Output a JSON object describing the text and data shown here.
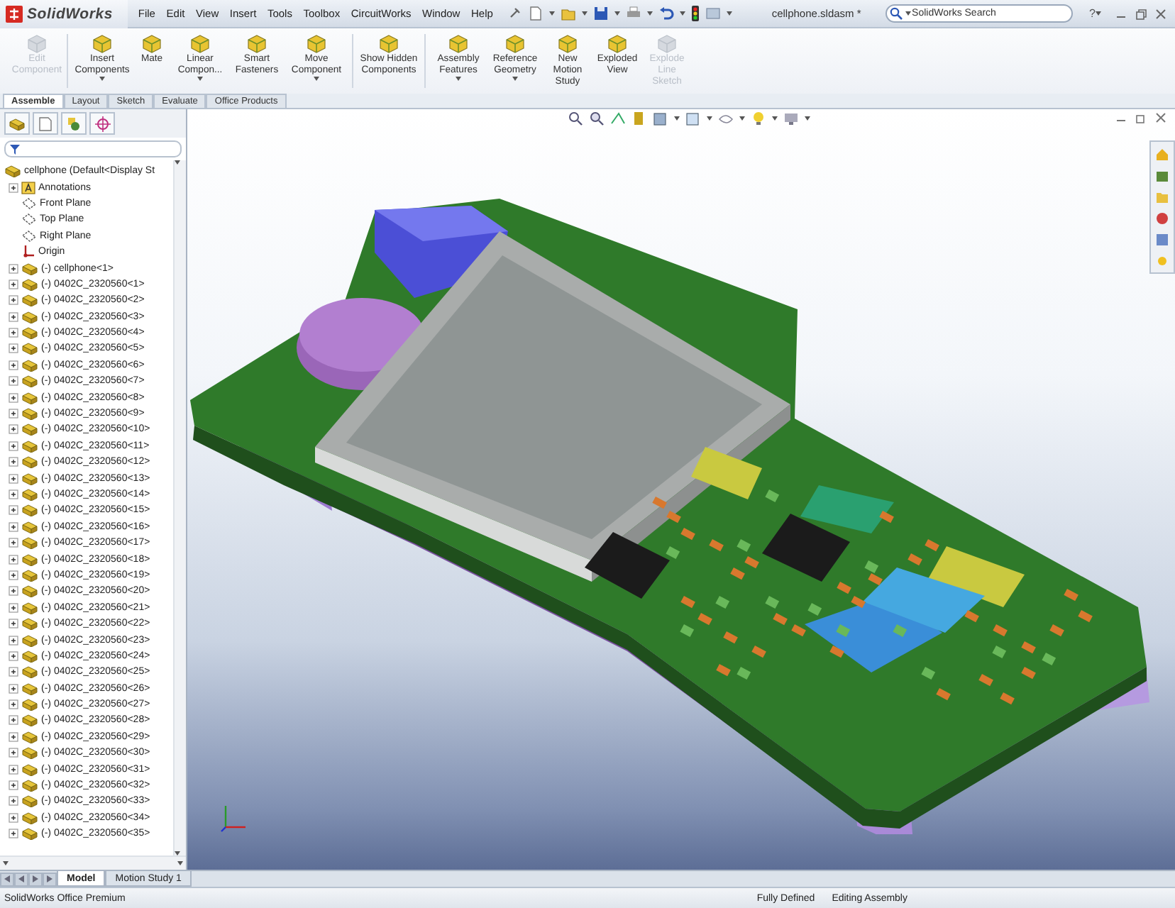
{
  "title_bar": {
    "app_name": "SolidWorks",
    "menu": [
      "File",
      "Edit",
      "View",
      "Insert",
      "Tools",
      "Toolbox",
      "CircuitWorks",
      "Window",
      "Help"
    ],
    "document_title": "cellphone.sldasm *",
    "search": {
      "placeholder": "SolidWorks Search"
    },
    "help_label": "?"
  },
  "ribbon": {
    "commands": [
      {
        "label": "Edit Component",
        "disabled": true,
        "dropdown": false
      },
      {
        "label": "Insert Components",
        "disabled": false,
        "dropdown": true
      },
      {
        "label": "Mate",
        "disabled": false,
        "dropdown": false
      },
      {
        "label": "Linear Compon...",
        "disabled": false,
        "dropdown": true
      },
      {
        "label": "Smart Fasteners",
        "disabled": false,
        "dropdown": false
      },
      {
        "label": "Move Component",
        "disabled": false,
        "dropdown": true
      },
      {
        "label": "Show Hidden Components",
        "disabled": false,
        "dropdown": false
      },
      {
        "label": "Assembly Features",
        "disabled": false,
        "dropdown": true
      },
      {
        "label": "Reference Geometry",
        "disabled": false,
        "dropdown": true
      },
      {
        "label": "New Motion Study",
        "disabled": false,
        "dropdown": false
      },
      {
        "label": "Exploded View",
        "disabled": false,
        "dropdown": false
      },
      {
        "label": "Explode Line Sketch",
        "disabled": true,
        "dropdown": false
      }
    ]
  },
  "command_tabs": [
    {
      "label": "Assemble",
      "selected": true
    },
    {
      "label": "Layout",
      "selected": false
    },
    {
      "label": "Sketch",
      "selected": false
    },
    {
      "label": "Evaluate",
      "selected": false
    },
    {
      "label": "Office Products",
      "selected": false
    }
  ],
  "feature_tree": {
    "root": {
      "label": "cellphone  (Default<Display St",
      "kind": "assembly",
      "children": [
        {
          "label": "Annotations",
          "kind": "annotations"
        },
        {
          "label": "Front Plane",
          "kind": "plane"
        },
        {
          "label": "Top Plane",
          "kind": "plane"
        },
        {
          "label": "Right Plane",
          "kind": "plane"
        },
        {
          "label": "Origin",
          "kind": "origin"
        },
        {
          "label": "(-) cellphone<1>",
          "kind": "component"
        },
        {
          "label": "(-) 0402C_2320560<1>",
          "kind": "component"
        },
        {
          "label": "(-) 0402C_2320560<2>",
          "kind": "component"
        },
        {
          "label": "(-) 0402C_2320560<3>",
          "kind": "component"
        },
        {
          "label": "(-) 0402C_2320560<4>",
          "kind": "component"
        },
        {
          "label": "(-) 0402C_2320560<5>",
          "kind": "component"
        },
        {
          "label": "(-) 0402C_2320560<6>",
          "kind": "component"
        },
        {
          "label": "(-) 0402C_2320560<7>",
          "kind": "component"
        },
        {
          "label": "(-) 0402C_2320560<8>",
          "kind": "component"
        },
        {
          "label": "(-) 0402C_2320560<9>",
          "kind": "component"
        },
        {
          "label": "(-) 0402C_2320560<10>",
          "kind": "component"
        },
        {
          "label": "(-) 0402C_2320560<11>",
          "kind": "component"
        },
        {
          "label": "(-) 0402C_2320560<12>",
          "kind": "component"
        },
        {
          "label": "(-) 0402C_2320560<13>",
          "kind": "component"
        },
        {
          "label": "(-) 0402C_2320560<14>",
          "kind": "component"
        },
        {
          "label": "(-) 0402C_2320560<15>",
          "kind": "component"
        },
        {
          "label": "(-) 0402C_2320560<16>",
          "kind": "component"
        },
        {
          "label": "(-) 0402C_2320560<17>",
          "kind": "component"
        },
        {
          "label": "(-) 0402C_2320560<18>",
          "kind": "component"
        },
        {
          "label": "(-) 0402C_2320560<19>",
          "kind": "component"
        },
        {
          "label": "(-) 0402C_2320560<20>",
          "kind": "component"
        },
        {
          "label": "(-) 0402C_2320560<21>",
          "kind": "component"
        },
        {
          "label": "(-) 0402C_2320560<22>",
          "kind": "component"
        },
        {
          "label": "(-) 0402C_2320560<23>",
          "kind": "component"
        },
        {
          "label": "(-) 0402C_2320560<24>",
          "kind": "component"
        },
        {
          "label": "(-) 0402C_2320560<25>",
          "kind": "component"
        },
        {
          "label": "(-) 0402C_2320560<26>",
          "kind": "component"
        },
        {
          "label": "(-) 0402C_2320560<27>",
          "kind": "component"
        },
        {
          "label": "(-) 0402C_2320560<28>",
          "kind": "component"
        },
        {
          "label": "(-) 0402C_2320560<29>",
          "kind": "component"
        },
        {
          "label": "(-) 0402C_2320560<30>",
          "kind": "component"
        },
        {
          "label": "(-) 0402C_2320560<31>",
          "kind": "component"
        },
        {
          "label": "(-) 0402C_2320560<32>",
          "kind": "component"
        },
        {
          "label": "(-) 0402C_2320560<33>",
          "kind": "component"
        },
        {
          "label": "(-) 0402C_2320560<34>",
          "kind": "component"
        },
        {
          "label": "(-) 0402C_2320560<35>",
          "kind": "component"
        }
      ]
    }
  },
  "bottom_tabs": [
    {
      "label": "Model",
      "selected": true
    },
    {
      "label": "Motion Study 1",
      "selected": false
    }
  ],
  "status_bar": {
    "product": "SolidWorks Office Premium",
    "sketch_status": "Fully Defined",
    "mode": "Editing Assembly"
  }
}
